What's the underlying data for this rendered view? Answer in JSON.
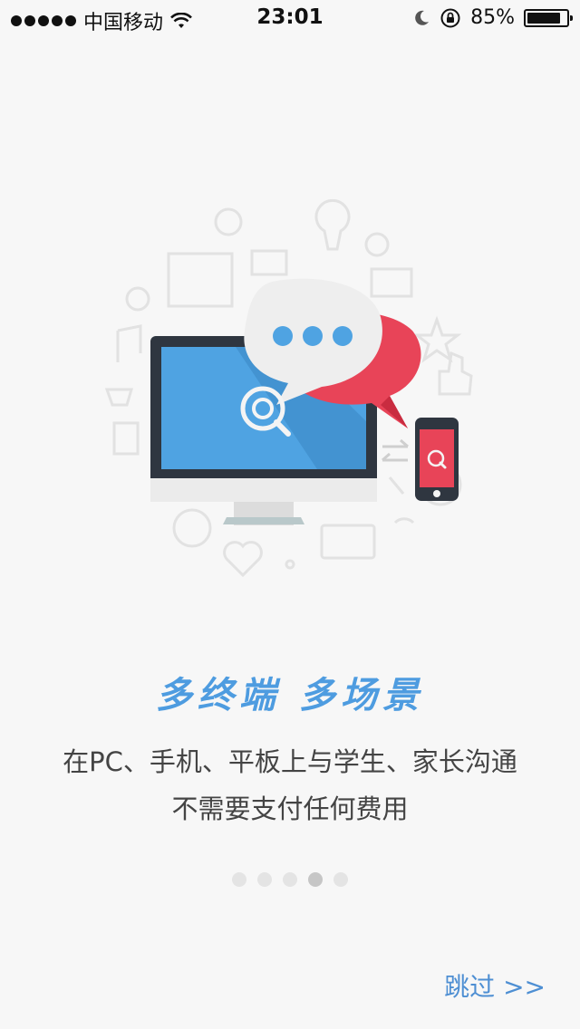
{
  "status_bar": {
    "carrier": "中国移动",
    "time": "23:01",
    "battery_percent_label": "85%",
    "battery_level": 0.85,
    "icons": [
      "signal-dots-icon",
      "wifi-icon",
      "moon-icon",
      "rotation-lock-icon",
      "battery-icon"
    ]
  },
  "onboarding": {
    "title": "多终端 多场景",
    "description_line1": "在PC、手机、平板上与学生、家长沟通",
    "description_line2": "不需要支付任何费用",
    "pager": {
      "total": 5,
      "active_index": 3
    },
    "skip_label": "跳过 >>"
  },
  "colors": {
    "accent_blue": "#4e9ce0",
    "bubble_red": "#e84458",
    "screen_blue": "#4fa3e2",
    "background": "#f7f7f7"
  }
}
